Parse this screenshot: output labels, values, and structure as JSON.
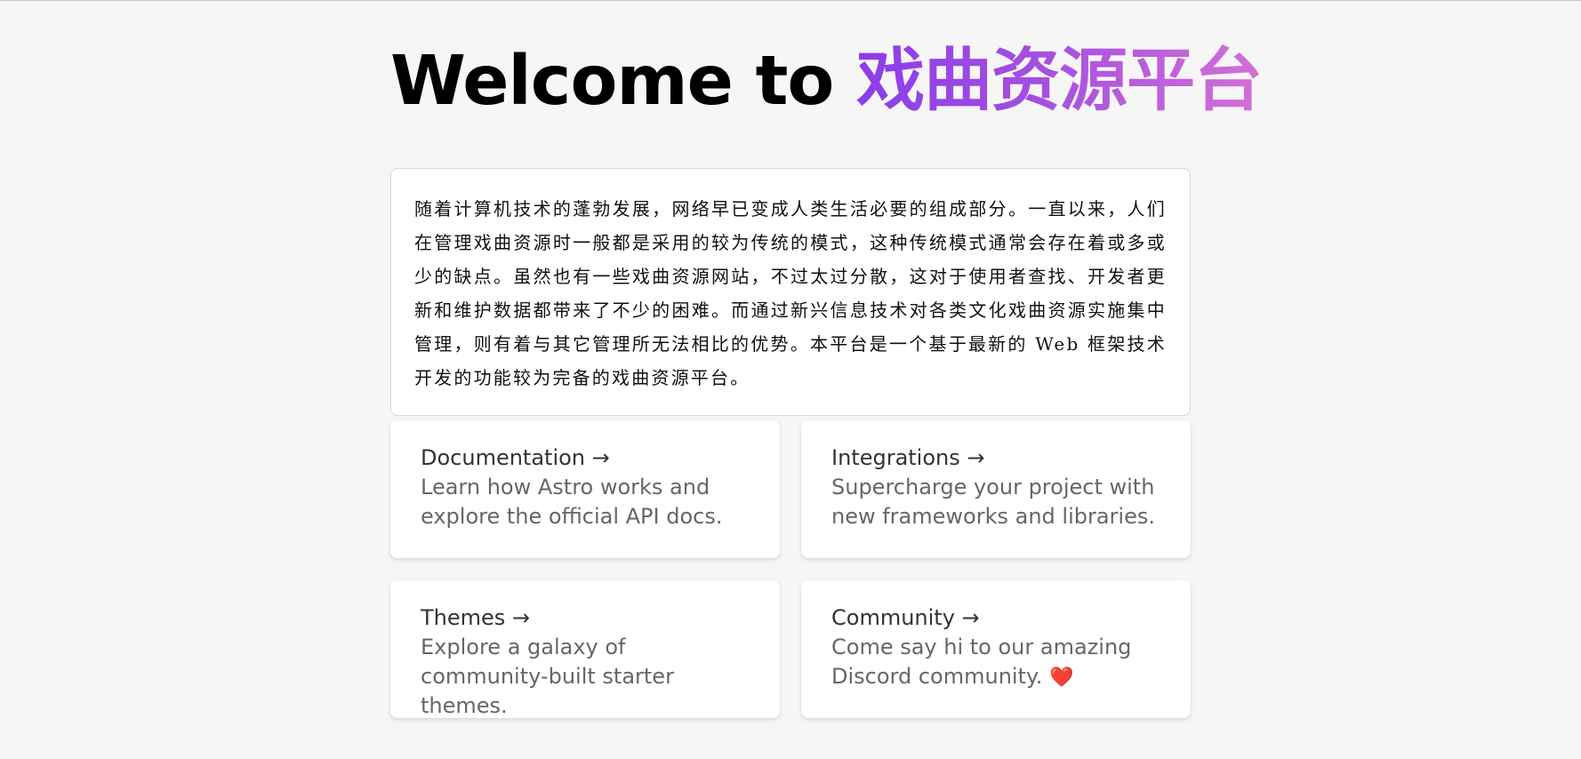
{
  "header": {
    "title_prefix": "Welcome to ",
    "title_highlight": "戏曲资源平台"
  },
  "intro": {
    "text": "随着计算机技术的蓬勃发展，网络早已变成人类生活必要的组成部分。一直以来，人们在管理戏曲资源时一般都是采用的较为传统的模式，这种传统模式通常会存在着或多或少的缺点。虽然也有一些戏曲资源网站，不过太过分散，这对于使用者查找、开发者更新和维护数据都带来了不少的困难。而通过新兴信息技术对各类文化戏曲资源实施集中管理，则有着与其它管理所无法相比的优势。本平台是一个基于最新的 Web 框架技术开发的功能较为完备的戏曲资源平台。"
  },
  "cards": [
    {
      "title": "Documentation →",
      "body": "Learn how Astro works and explore the official API docs."
    },
    {
      "title": "Integrations →",
      "body": "Supercharge your project with new frameworks and libraries."
    },
    {
      "title": "Themes →",
      "body": "Explore a galaxy of community-built starter themes."
    },
    {
      "title": "Community →",
      "body": "Come say hi to our amazing Discord community.",
      "emoji": "❤️"
    }
  ],
  "colors": {
    "background": "#f6f6f6",
    "gradient_start": "#8b3dea",
    "gradient_end": "#d46fd8",
    "intro_border": "#d6d2f2",
    "heart": "#e43b4f"
  }
}
